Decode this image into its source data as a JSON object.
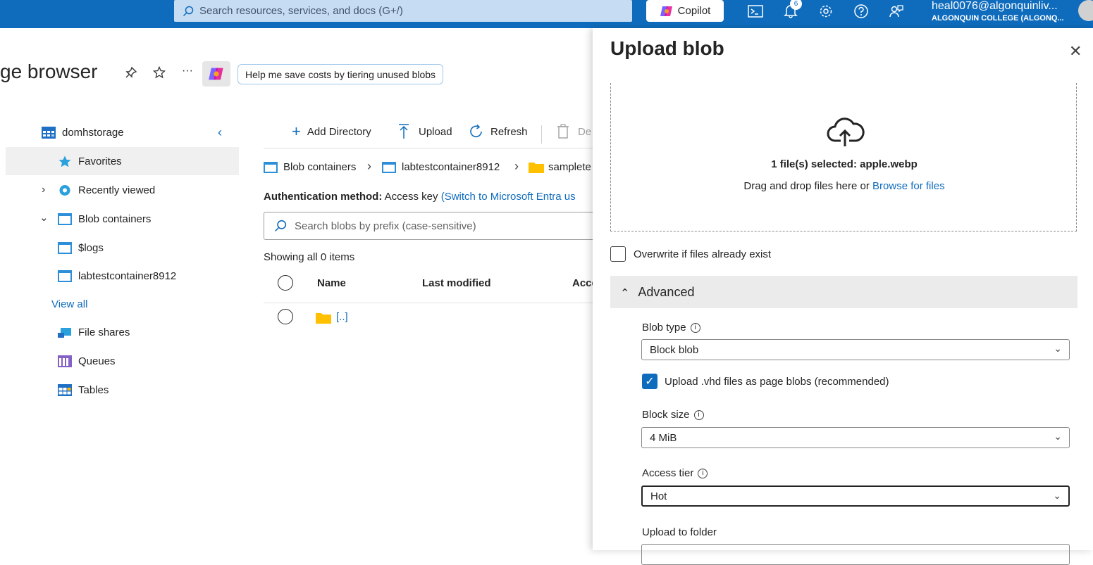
{
  "topbar": {
    "search_placeholder": "Search resources, services, and docs (G+/)",
    "copilot_label": "Copilot",
    "notification_count": "6",
    "account_user": "heal0076@algonquinliv...",
    "account_org": "ALGONQUIN COLLEGE (ALGONQ..."
  },
  "page": {
    "title": "ge browser",
    "save_costs_label": "Help me save costs by tiering unused blobs"
  },
  "tree": {
    "account": "domhstorage",
    "favorites": "Favorites",
    "recently_viewed": "Recently viewed",
    "blob_containers": "Blob containers",
    "containers": [
      "$logs",
      "labtestcontainer8912"
    ],
    "view_all": "View all",
    "file_shares": "File shares",
    "queues": "Queues",
    "tables": "Tables"
  },
  "toolbar": {
    "add_directory": "Add Directory",
    "upload": "Upload",
    "refresh": "Refresh",
    "delete": "De"
  },
  "breadcrumb": [
    "Blob containers",
    "labtestcontainer8912",
    "samplete"
  ],
  "auth": {
    "label": "Authentication method:",
    "value": "Access key",
    "switch_link": "(Switch to Microsoft Entra us"
  },
  "blob_search_placeholder": "Search blobs by prefix (case-sensitive)",
  "showing": "Showing all 0 items",
  "table": {
    "columns": [
      "Name",
      "Last modified",
      "Acce"
    ],
    "rows": [
      {
        "name": "[..]"
      }
    ]
  },
  "panel": {
    "title": "Upload blob",
    "selected": "1 file(s) selected: apple.webp",
    "drag_text": "Drag and drop files here",
    "or": "or",
    "browse": "Browse for files",
    "overwrite_label": "Overwrite if files already exist",
    "overwrite_checked": false,
    "advanced_label": "Advanced",
    "blob_type_label": "Blob type",
    "blob_type_value": "Block blob",
    "vhd_label": "Upload .vhd files as page blobs (recommended)",
    "vhd_checked": true,
    "block_size_label": "Block size",
    "block_size_value": "4 MiB",
    "access_tier_label": "Access tier",
    "access_tier_value": "Hot",
    "upload_folder_label": "Upload to folder"
  },
  "colors": {
    "brand": "#0f6cbd",
    "search_bg": "#c5dcf3"
  }
}
